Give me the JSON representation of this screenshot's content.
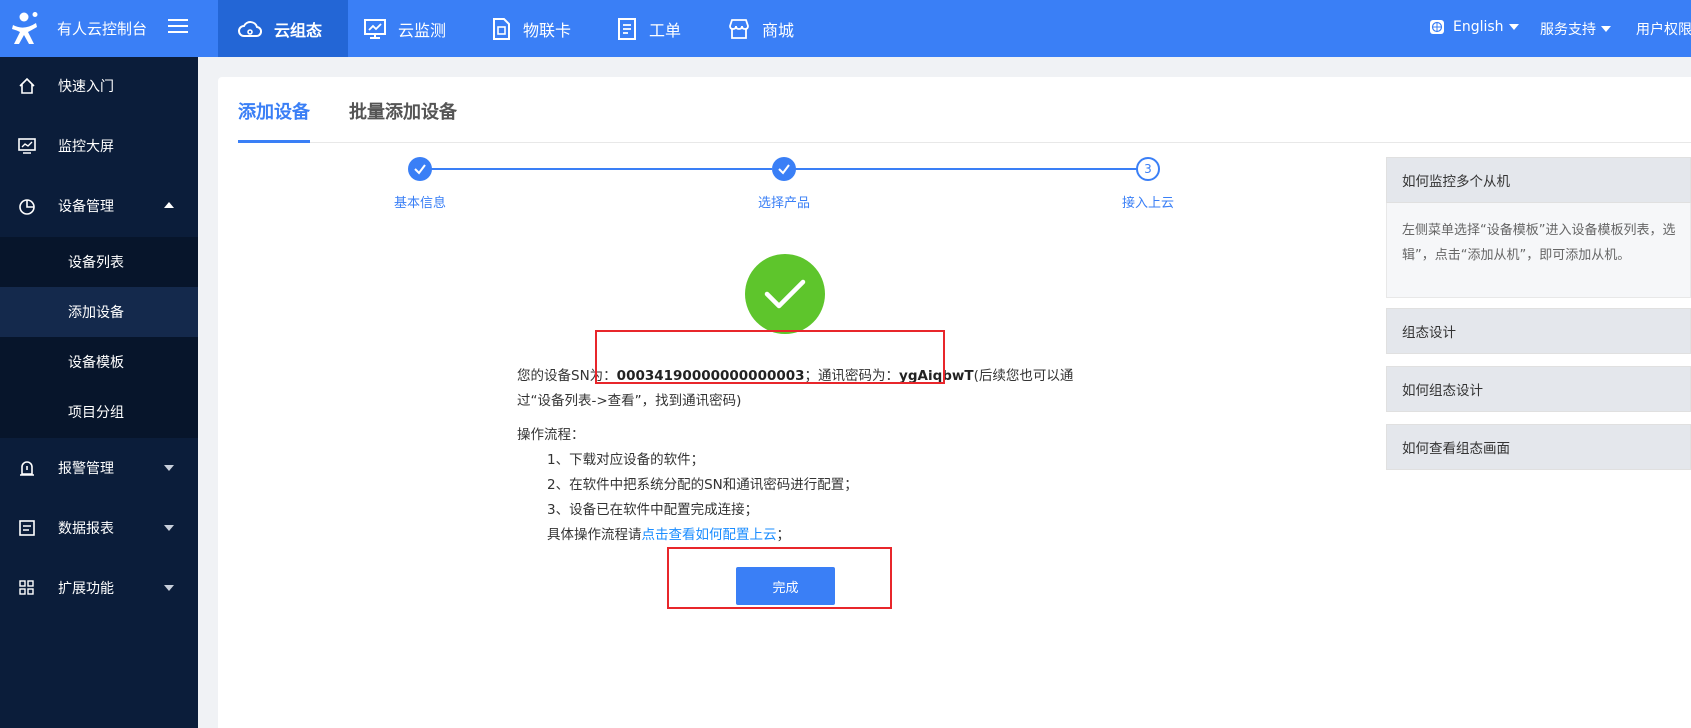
{
  "header": {
    "brand": "有人云控制台",
    "nav": [
      {
        "label": "云组态",
        "icon": "cloud-icon"
      },
      {
        "label": "云监测",
        "icon": "monitor-chart-icon"
      },
      {
        "label": "物联卡",
        "icon": "sim-card-icon"
      },
      {
        "label": "工单",
        "icon": "ticket-icon"
      },
      {
        "label": "商城",
        "icon": "shop-icon"
      }
    ],
    "language": "English",
    "support": "服务支持",
    "user_perm": "用户权限"
  },
  "sidebar": {
    "items": [
      {
        "label": "快速入门",
        "icon": "home-icon"
      },
      {
        "label": "监控大屏",
        "icon": "screen-icon"
      },
      {
        "label": "设备管理",
        "icon": "pie-icon"
      },
      {
        "label": "报警管理",
        "icon": "alarm-icon"
      },
      {
        "label": "数据报表",
        "icon": "report-icon"
      },
      {
        "label": "扩展功能",
        "icon": "grid-icon"
      }
    ],
    "submenu": [
      "设备列表",
      "添加设备",
      "设备模板",
      "项目分组"
    ]
  },
  "tabs": [
    "添加设备",
    "批量添加设备"
  ],
  "steps": [
    {
      "label": "基本信息",
      "state": "done"
    },
    {
      "label": "选择产品",
      "state": "done"
    },
    {
      "label": "接入上云",
      "state": "current",
      "number": "3"
    }
  ],
  "result": {
    "sn_prefix": "您的设备SN为：",
    "sn": "00034190000000000003",
    "pwd_prefix": "；通讯密码为：",
    "pwd": "ygAiqbwT",
    "suffix": "(后续您也可以通",
    "line2": "过“设备列表->查看”，找到通讯密码)",
    "process_title": "操作流程：",
    "process_steps": [
      "1、下载对应设备的软件；",
      "2、在软件中把系统分配的SN和通讯密码进行配置；",
      "3、设备已在软件中配置完成连接；"
    ],
    "detail_prefix": "具体操作流程请",
    "detail_link": "点击查看如何配置上云",
    "detail_suffix": "；",
    "done_button": "完成"
  },
  "faq": [
    {
      "title": "如何监控多个从机",
      "body_line1": "左侧菜单选择“设备模板”进入设备模板列表，选",
      "body_line2": "辑”，点击“添加从机”，即可添加从机。"
    },
    {
      "title": "组态设计"
    },
    {
      "title": "如何组态设计"
    },
    {
      "title": "如何查看组态画面"
    }
  ],
  "colors": {
    "primary": "#3a7ff6",
    "sidebar": "#0b1d3a",
    "success": "#5ec52c",
    "highlight": "#e8262b"
  }
}
